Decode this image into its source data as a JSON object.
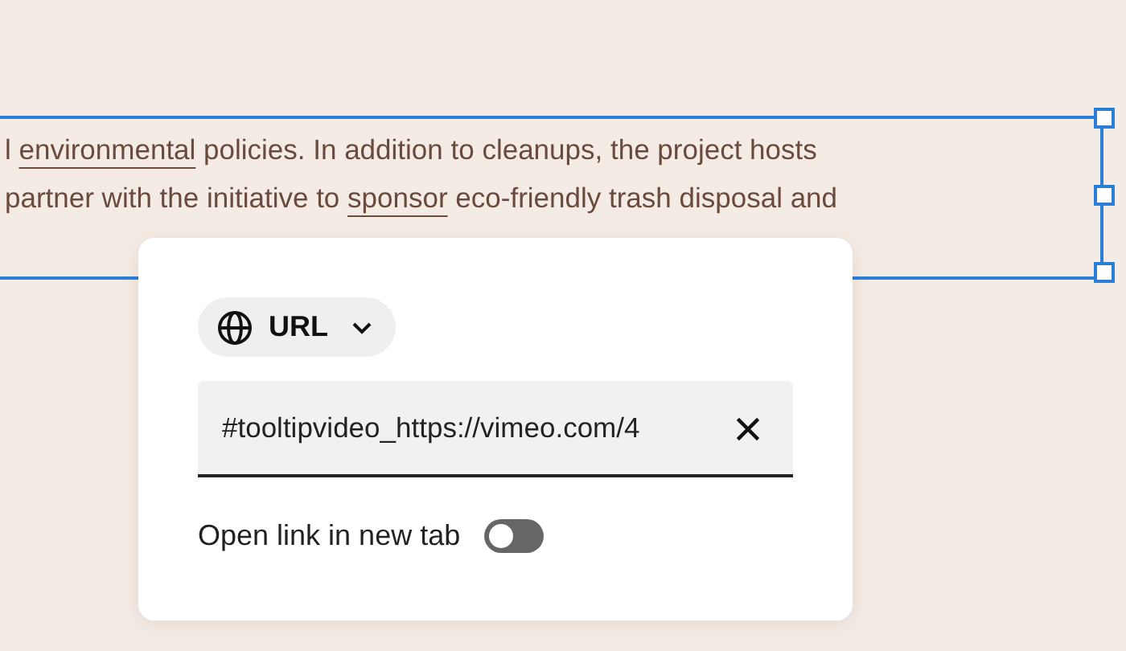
{
  "paragraph": {
    "lines": [
      [
        {
          "text": "l "
        },
        {
          "text": "environmental",
          "link": true
        },
        {
          "text": " policies. In addition to cleanups, the project hosts"
        }
      ],
      [
        {
          "text": " partner with the initiative to "
        },
        {
          "text": "sponsor",
          "link": true
        },
        {
          "text": " eco-friendly trash disposal and"
        }
      ]
    ],
    "selected": true
  },
  "popup": {
    "link_type": {
      "label": "URL"
    },
    "url_field": {
      "value": "#tooltipvideo_https://vimeo.com/4"
    },
    "new_tab": {
      "label": "Open link in new tab",
      "on": false
    }
  }
}
